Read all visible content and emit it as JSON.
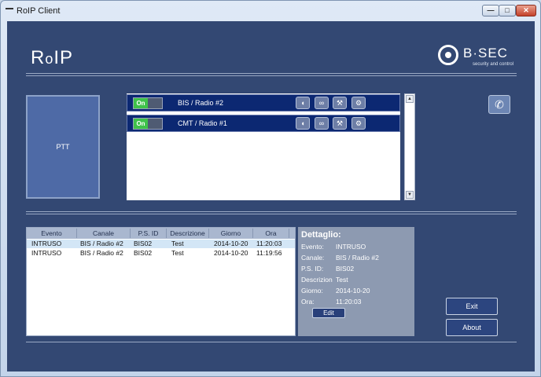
{
  "window": {
    "title": "RoIP Client",
    "min_label": "—",
    "max_label": "□",
    "close_label": "✕"
  },
  "brand": {
    "app_logo_prefix": "R",
    "app_logo_o": "o",
    "app_logo_suffix": "IP",
    "company": "B·SEC",
    "company_tagline": "security and control"
  },
  "ptt": {
    "label": "PTT"
  },
  "channels": [
    {
      "state": "On",
      "name": "BIS / Radio #2",
      "icons": [
        "speaker-icon",
        "link-icon",
        "wrench-icon",
        "gear-icon"
      ]
    },
    {
      "state": "On",
      "name": "CMT / Radio #1",
      "icons": [
        "speaker-icon",
        "link-icon",
        "wrench-icon",
        "gear-icon"
      ]
    }
  ],
  "icon_glyphs": {
    "speaker": "◖",
    "link": "∞",
    "wrench": "⚒",
    "gear": "⚙",
    "phone": "✆",
    "up": "▲",
    "down": "▼"
  },
  "log": {
    "columns": [
      "Evento",
      "Canale",
      "P.S. ID",
      "Descrizione",
      "Giorno",
      "Ora"
    ],
    "rows": [
      {
        "evento": "INTRUSO",
        "canale": "BIS / Radio #2",
        "ps_id": "BIS02",
        "descrizione": "Test",
        "giorno": "2014-10-20",
        "ora": "11:20:03",
        "selected": true
      },
      {
        "evento": "INTRUSO",
        "canale": "BIS / Radio #2",
        "ps_id": "BIS02",
        "descrizione": "Test",
        "giorno": "2014-10-20",
        "ora": "11:19:56",
        "selected": false
      }
    ]
  },
  "detail": {
    "title": "Dettaglio:",
    "fields": [
      {
        "label": "Evento:",
        "value": "INTRUSO"
      },
      {
        "label": "Canale:",
        "value": "BIS / Radio #2"
      },
      {
        "label": "P.S. ID:",
        "value": "BIS02"
      },
      {
        "label": "Descrizion",
        "value": "Test"
      },
      {
        "label": "Giorno:",
        "value": "2014-10-20"
      },
      {
        "label": "Ora:",
        "value": "11:20:03"
      }
    ],
    "edit_label": "Edit"
  },
  "buttons": {
    "exit": "Exit",
    "about": "About"
  },
  "colors": {
    "background": "#334873",
    "channel_row": "#0c2872",
    "toggle_on": "#3fc24a",
    "selected_row": "#d3e6f6",
    "detail_panel": "#8d9ab1"
  }
}
